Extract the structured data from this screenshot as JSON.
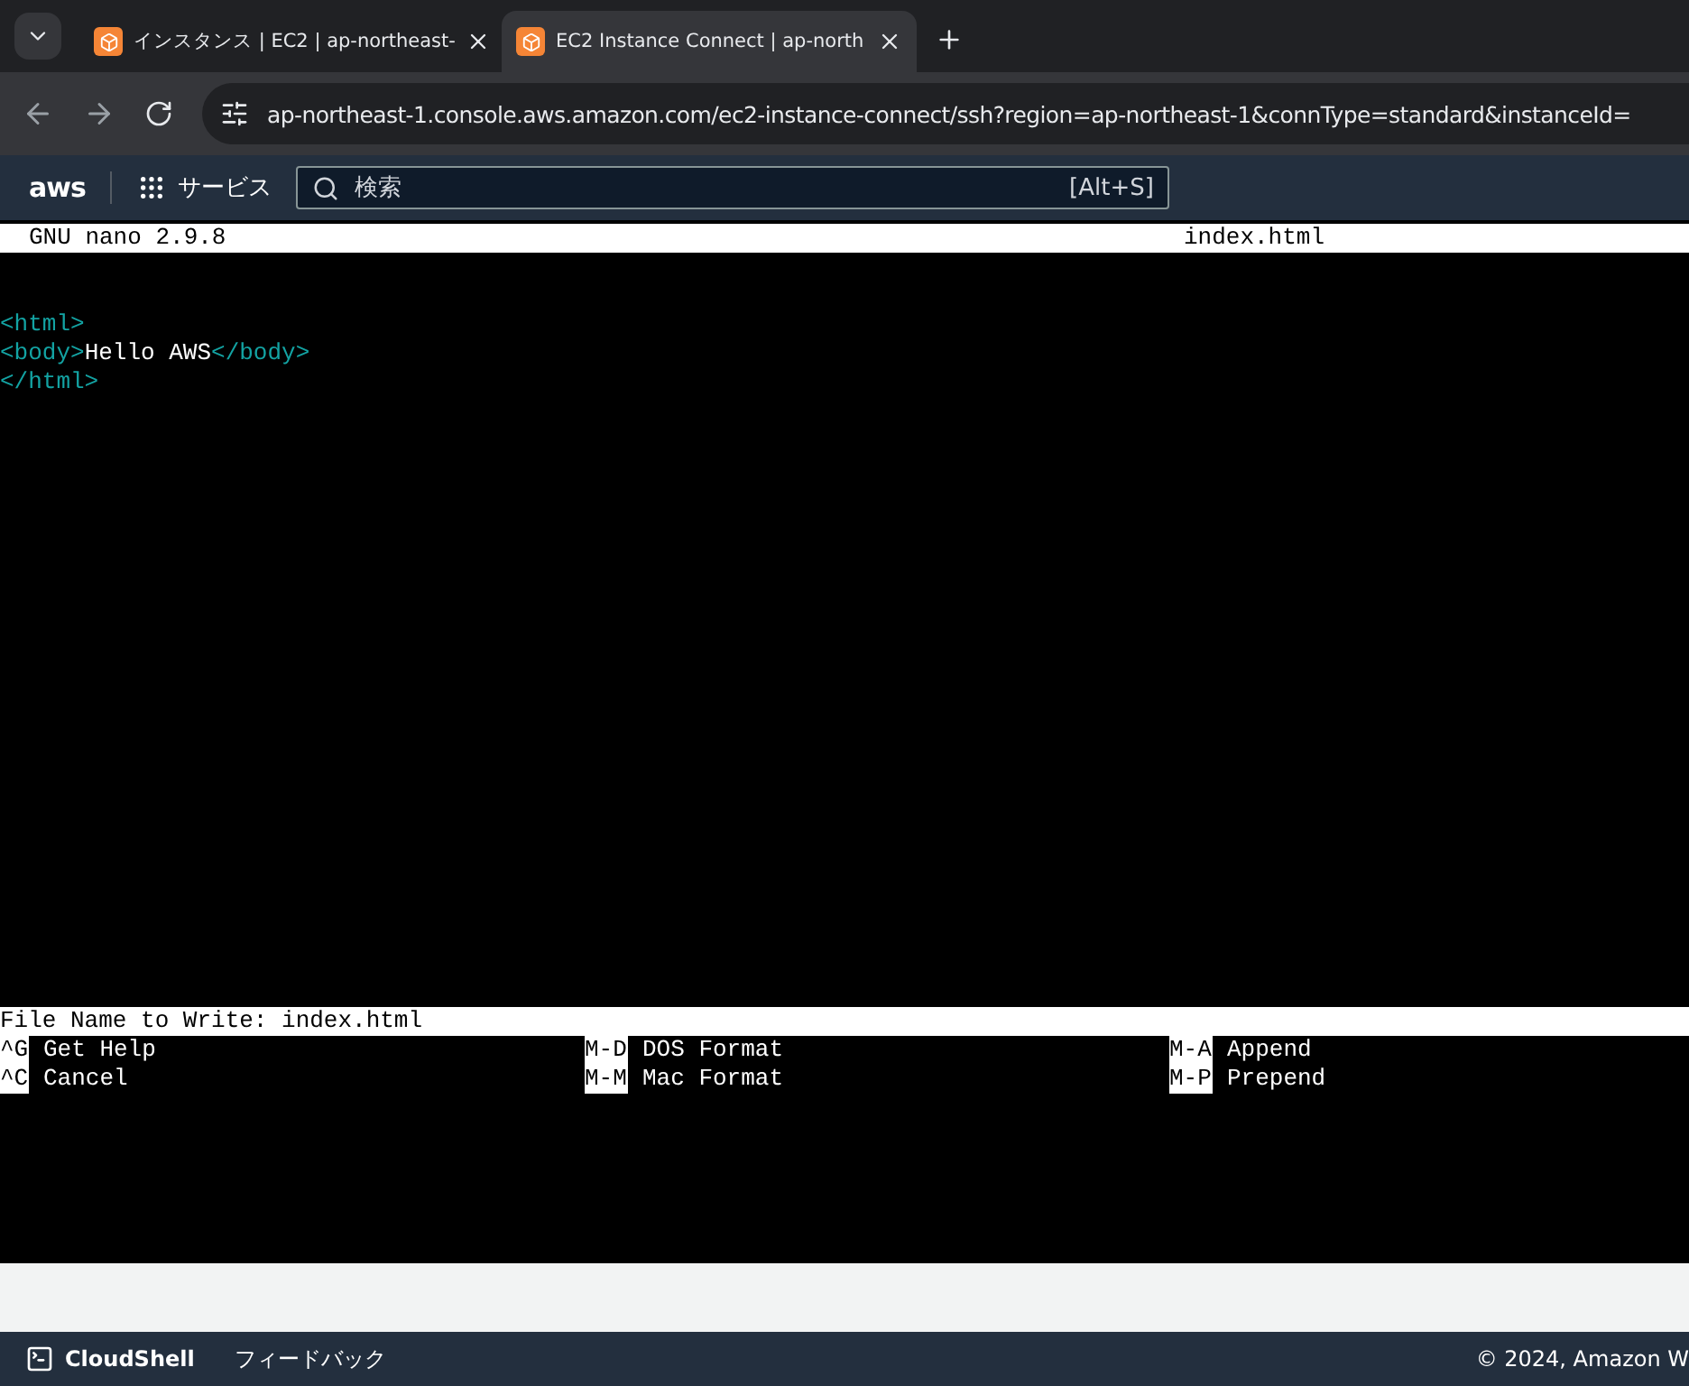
{
  "browser": {
    "tabs": [
      {
        "title": "インスタンス | EC2 | ap-northeast-",
        "selected": false
      },
      {
        "title": "EC2 Instance Connect | ap-north",
        "selected": true
      }
    ],
    "url": "ap-northeast-1.console.aws.amazon.com/ec2-instance-connect/ssh?region=ap-northeast-1&connType=standard&instanceId="
  },
  "aws_nav": {
    "logo": "aws",
    "services": "サービス",
    "search": {
      "placeholder": "検索",
      "shortcut": "[Alt+S]"
    }
  },
  "nano": {
    "version": "GNU nano 2.9.8",
    "filename": "index.html",
    "lines": [
      [
        {
          "kind": "tag",
          "text": "<html>"
        }
      ],
      [
        {
          "kind": "tag",
          "text": "<body>"
        },
        {
          "kind": "text",
          "text": "Hello AWS"
        },
        {
          "kind": "tag",
          "text": "</body>"
        }
      ],
      [
        {
          "kind": "tag",
          "text": "</html>"
        }
      ]
    ],
    "prompt": "File Name to Write: index.html",
    "shortcuts": [
      [
        {
          "key": "^G",
          "label": "Get Help"
        },
        {
          "key": "M-D",
          "label": "DOS Format"
        },
        {
          "key": "M-A",
          "label": "Append"
        }
      ],
      [
        {
          "key": "^C",
          "label": "Cancel"
        },
        {
          "key": "M-M",
          "label": "Mac Format"
        },
        {
          "key": "M-P",
          "label": "Prepend"
        }
      ]
    ]
  },
  "footer": {
    "cloudshell": "CloudShell",
    "feedback": "フィードバック",
    "copyright": "© 2024, Amazon W"
  }
}
